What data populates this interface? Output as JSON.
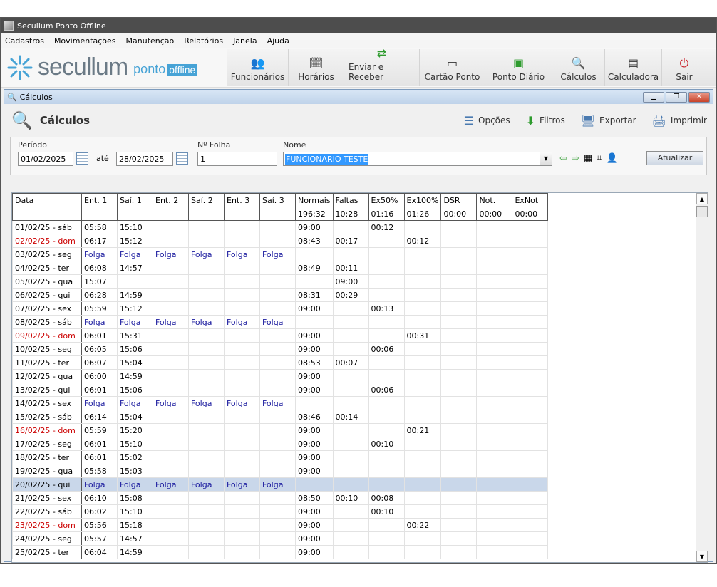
{
  "app": {
    "title": "Secullum Ponto Offline"
  },
  "menu": [
    "Cadastros",
    "Movimentações",
    "Manutenção",
    "Relatórios",
    "Janela",
    "Ajuda"
  ],
  "logo": {
    "brand": "secullum",
    "product": "ponto",
    "edition": "offline"
  },
  "toolbar": [
    {
      "label": "Funcionários",
      "icon": "users-icon"
    },
    {
      "label": "Horários",
      "icon": "schedule-icon"
    },
    {
      "label": "Enviar e Receber",
      "icon": "sync-icon"
    },
    {
      "label": "Cartão Ponto",
      "icon": "card-icon"
    },
    {
      "label": "Ponto Diário",
      "icon": "daily-icon"
    },
    {
      "label": "Cálculos",
      "icon": "calc-search-icon"
    },
    {
      "label": "Calculadora",
      "icon": "calculator-icon"
    },
    {
      "label": "Sair",
      "icon": "power-icon"
    }
  ],
  "child": {
    "title": "Cálculos",
    "header": "Cálculos",
    "actions": {
      "opcoes": "Opções",
      "filtros": "Filtros",
      "exportar": "Exportar",
      "imprimir": "Imprimir"
    }
  },
  "filters": {
    "periodo_label": "Período",
    "start": "01/02/2025",
    "ate": "até",
    "end": "28/02/2025",
    "folha_label": "Nº Folha",
    "folha": "1",
    "nome_label": "Nome",
    "nome": "FUNCIONARIO TESTE",
    "atualizar": "Atualizar"
  },
  "grid": {
    "headers": [
      "Data",
      "Ent. 1",
      "Saí. 1",
      "Ent. 2",
      "Saí. 2",
      "Ent. 3",
      "Saí. 3",
      "Normais",
      "Faltas",
      "Ex50%",
      "Ex100%",
      "DSR",
      "Not.",
      "ExNot"
    ],
    "totals": [
      "",
      "",
      "",
      "",
      "",
      "",
      "",
      "196:32",
      "10:28",
      "01:16",
      "01:26",
      "00:00",
      "00:00",
      "00:00"
    ],
    "rows": [
      {
        "kind": "",
        "cells": [
          "01/02/25 - sáb",
          "05:58",
          "15:10",
          "",
          "",
          "",
          "",
          "09:00",
          "",
          "00:12",
          "",
          "",
          "",
          ""
        ]
      },
      {
        "kind": "sun",
        "cells": [
          "02/02/25 - dom",
          "06:17",
          "15:12",
          "",
          "",
          "",
          "",
          "08:43",
          "00:17",
          "",
          "00:12",
          "",
          "",
          ""
        ]
      },
      {
        "kind": "folga",
        "cells": [
          "03/02/25 - seg",
          "Folga",
          "Folga",
          "Folga",
          "Folga",
          "Folga",
          "Folga",
          "",
          "",
          "",
          "",
          "",
          "",
          ""
        ]
      },
      {
        "kind": "",
        "cells": [
          "04/02/25 - ter",
          "06:08",
          "14:57",
          "",
          "",
          "",
          "",
          "08:49",
          "00:11",
          "",
          "",
          "",
          "",
          ""
        ]
      },
      {
        "kind": "",
        "cells": [
          "05/02/25 - qua",
          "15:07",
          "",
          "",
          "",
          "",
          "",
          "",
          "09:00",
          "",
          "",
          "",
          "",
          ""
        ]
      },
      {
        "kind": "",
        "cells": [
          "06/02/25 - qui",
          "06:28",
          "14:59",
          "",
          "",
          "",
          "",
          "08:31",
          "00:29",
          "",
          "",
          "",
          "",
          ""
        ]
      },
      {
        "kind": "",
        "cells": [
          "07/02/25 - sex",
          "05:59",
          "15:12",
          "",
          "",
          "",
          "",
          "09:00",
          "",
          "00:13",
          "",
          "",
          "",
          ""
        ]
      },
      {
        "kind": "folga",
        "cells": [
          "08/02/25 - sáb",
          "Folga",
          "Folga",
          "Folga",
          "Folga",
          "Folga",
          "Folga",
          "",
          "",
          "",
          "",
          "",
          "",
          ""
        ]
      },
      {
        "kind": "sun",
        "cells": [
          "09/02/25 - dom",
          "06:01",
          "15:31",
          "",
          "",
          "",
          "",
          "09:00",
          "",
          "",
          "00:31",
          "",
          "",
          ""
        ]
      },
      {
        "kind": "",
        "cells": [
          "10/02/25 - seg",
          "06:05",
          "15:06",
          "",
          "",
          "",
          "",
          "09:00",
          "",
          "00:06",
          "",
          "",
          "",
          ""
        ]
      },
      {
        "kind": "",
        "cells": [
          "11/02/25 - ter",
          "06:07",
          "15:04",
          "",
          "",
          "",
          "",
          "08:53",
          "00:07",
          "",
          "",
          "",
          "",
          ""
        ]
      },
      {
        "kind": "",
        "cells": [
          "12/02/25 - qua",
          "06:00",
          "14:59",
          "",
          "",
          "",
          "",
          "09:00",
          "",
          "",
          "",
          "",
          "",
          ""
        ]
      },
      {
        "kind": "",
        "cells": [
          "13/02/25 - qui",
          "06:01",
          "15:06",
          "",
          "",
          "",
          "",
          "09:00",
          "",
          "00:06",
          "",
          "",
          "",
          ""
        ]
      },
      {
        "kind": "folga",
        "cells": [
          "14/02/25 - sex",
          "Folga",
          "Folga",
          "Folga",
          "Folga",
          "Folga",
          "Folga",
          "",
          "",
          "",
          "",
          "",
          "",
          ""
        ]
      },
      {
        "kind": "",
        "cells": [
          "15/02/25 - sáb",
          "06:14",
          "15:04",
          "",
          "",
          "",
          "",
          "08:46",
          "00:14",
          "",
          "",
          "",
          "",
          ""
        ]
      },
      {
        "kind": "sun",
        "cells": [
          "16/02/25 - dom",
          "05:59",
          "15:20",
          "",
          "",
          "",
          "",
          "09:00",
          "",
          "",
          "00:21",
          "",
          "",
          ""
        ]
      },
      {
        "kind": "",
        "cells": [
          "17/02/25 - seg",
          "06:01",
          "15:10",
          "",
          "",
          "",
          "",
          "09:00",
          "",
          "00:10",
          "",
          "",
          "",
          ""
        ]
      },
      {
        "kind": "",
        "cells": [
          "18/02/25 - ter",
          "06:01",
          "15:02",
          "",
          "",
          "",
          "",
          "09:00",
          "",
          "",
          "",
          "",
          "",
          ""
        ]
      },
      {
        "kind": "",
        "cells": [
          "19/02/25 - qua",
          "05:58",
          "15:03",
          "",
          "",
          "",
          "",
          "09:00",
          "",
          "",
          "",
          "",
          "",
          ""
        ]
      },
      {
        "kind": "folga sel",
        "cells": [
          "20/02/25 - qui",
          "Folga",
          "Folga",
          "Folga",
          "Folga",
          "Folga",
          "Folga",
          "",
          "",
          "",
          "",
          "",
          "",
          ""
        ]
      },
      {
        "kind": "",
        "cells": [
          "21/02/25 - sex",
          "06:10",
          "15:08",
          "",
          "",
          "",
          "",
          "08:50",
          "00:10",
          "00:08",
          "",
          "",
          "",
          ""
        ]
      },
      {
        "kind": "",
        "cells": [
          "22/02/25 - sáb",
          "06:02",
          "15:10",
          "",
          "",
          "",
          "",
          "09:00",
          "",
          "00:10",
          "",
          "",
          "",
          ""
        ]
      },
      {
        "kind": "sun",
        "cells": [
          "23/02/25 - dom",
          "05:56",
          "15:18",
          "",
          "",
          "",
          "",
          "09:00",
          "",
          "",
          "00:22",
          "",
          "",
          ""
        ]
      },
      {
        "kind": "",
        "cells": [
          "24/02/25 - seg",
          "05:57",
          "14:57",
          "",
          "",
          "",
          "",
          "09:00",
          "",
          "",
          "",
          "",
          "",
          ""
        ]
      },
      {
        "kind": "",
        "cells": [
          "25/02/25 - ter",
          "06:04",
          "14:59",
          "",
          "",
          "",
          "",
          "09:00",
          "",
          "",
          "",
          "",
          "",
          ""
        ]
      }
    ]
  }
}
